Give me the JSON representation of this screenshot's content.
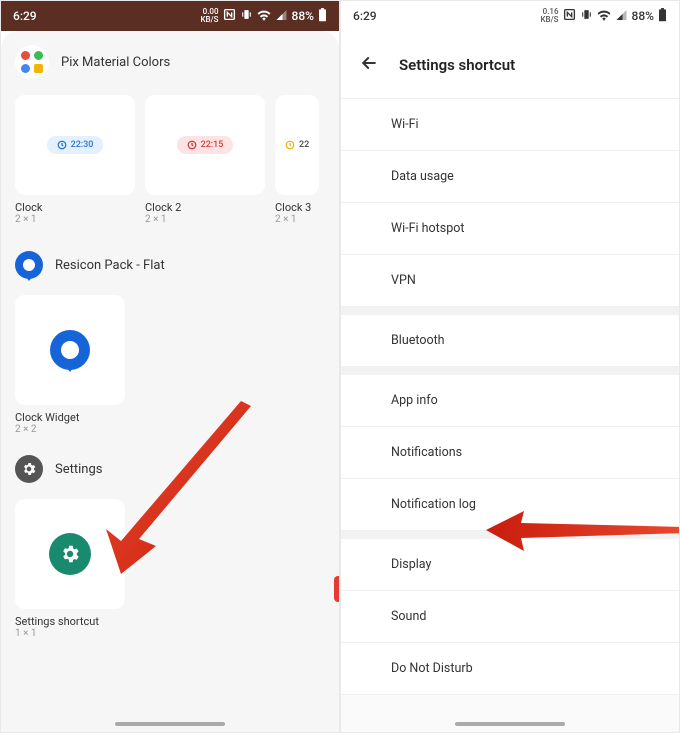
{
  "left": {
    "status": {
      "time": "6:29",
      "speed": "0.00",
      "speed_unit": "KB/S",
      "battery": "88%"
    },
    "section1": {
      "title": "Pix Material Colors",
      "widgets": [
        {
          "time": "22:30",
          "name": "Clock",
          "dim": "2 × 1",
          "style": "blue"
        },
        {
          "time": "22:15",
          "name": "Clock 2",
          "dim": "2 × 1",
          "style": "red"
        },
        {
          "time": "22",
          "name": "Clock 3",
          "dim": "2 × 1",
          "style": "plain"
        }
      ]
    },
    "section2": {
      "title": "Resicon Pack - Flat",
      "widget": {
        "name": "Clock Widget",
        "dim": "2 × 2"
      }
    },
    "section3": {
      "title": "Settings",
      "widget": {
        "name": "Settings shortcut",
        "dim": "1 × 1"
      }
    }
  },
  "rightp": {
    "status": {
      "time": "6:29",
      "speed": "0.16",
      "speed_unit": "KB/S",
      "battery": "88%"
    },
    "title": "Settings shortcut",
    "items": [
      "Wi-Fi",
      "Data usage",
      "Wi-Fi hotspot",
      "VPN",
      "Bluetooth",
      "App info",
      "Notifications",
      "Notification log",
      "Display",
      "Sound",
      "Do Not Disturb"
    ]
  }
}
